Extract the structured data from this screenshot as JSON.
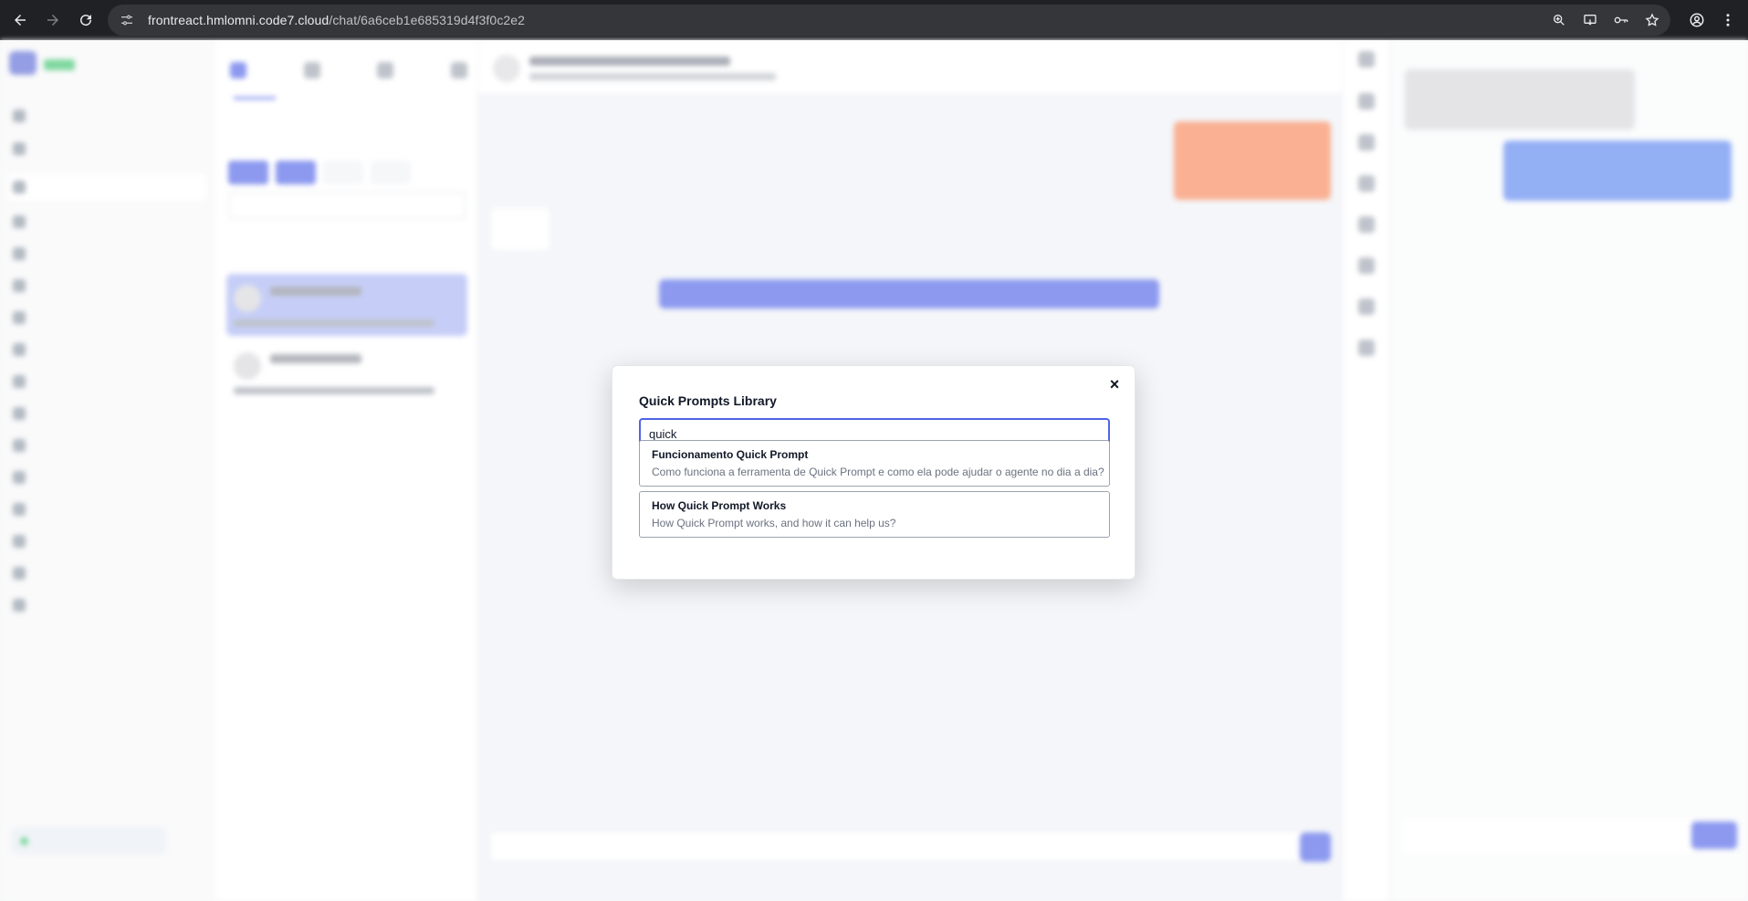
{
  "browser": {
    "url_host": "frontreact.hmlomni.code7.cloud",
    "url_path": "/chat/6a6ceb1e685319d4f3f0c2e2"
  },
  "modal": {
    "title": "Quick Prompts Library",
    "search_value": "quick",
    "close_glyph": "×",
    "results": [
      {
        "title": "Funcionamento Quick Prompt",
        "description": "Como funciona a ferramenta de Quick Prompt e como ela pode ajudar o agente no dia a dia?"
      },
      {
        "title": "How Quick Prompt Works",
        "description": "How Quick Prompt works, and how it can help us?"
      }
    ]
  },
  "icons": {
    "back": "arrow-left-icon",
    "forward": "arrow-right-icon",
    "reload": "reload-icon",
    "site_settings": "tune-icon",
    "zoom": "zoom-icon",
    "cast": "cast-icon",
    "password": "key-icon",
    "bookmark": "star-icon",
    "profile": "profile-icon",
    "menu": "kebab-icon"
  }
}
